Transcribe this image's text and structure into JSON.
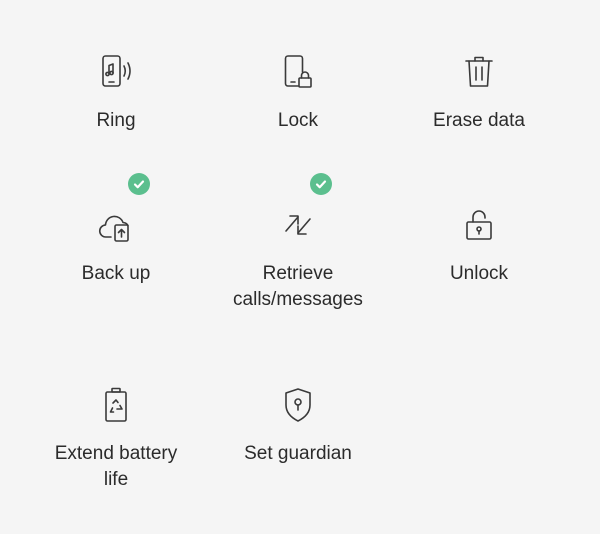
{
  "colors": {
    "background": "#f5f5f5",
    "icon_stroke": "#3a3a3a",
    "check_badge": "#5bbf8e",
    "text": "#2b2b2b"
  },
  "actions": [
    {
      "label": "Ring",
      "icon": "phone-ring-icon",
      "checked": false
    },
    {
      "label": "Lock",
      "icon": "phone-lock-icon",
      "checked": false
    },
    {
      "label": "Erase data",
      "icon": "trash-icon",
      "checked": false
    },
    {
      "label": "Back up",
      "icon": "cloud-backup-icon",
      "checked": true
    },
    {
      "label": "Retrieve\ncalls/messages",
      "icon": "transfer-arrows-icon",
      "checked": true
    },
    {
      "label": "Unlock",
      "icon": "unlock-icon",
      "checked": false
    },
    {
      "label": "Extend battery\nlife",
      "icon": "battery-recycle-icon",
      "checked": false
    },
    {
      "label": "Set guardian",
      "icon": "shield-keyhole-icon",
      "checked": false
    }
  ]
}
